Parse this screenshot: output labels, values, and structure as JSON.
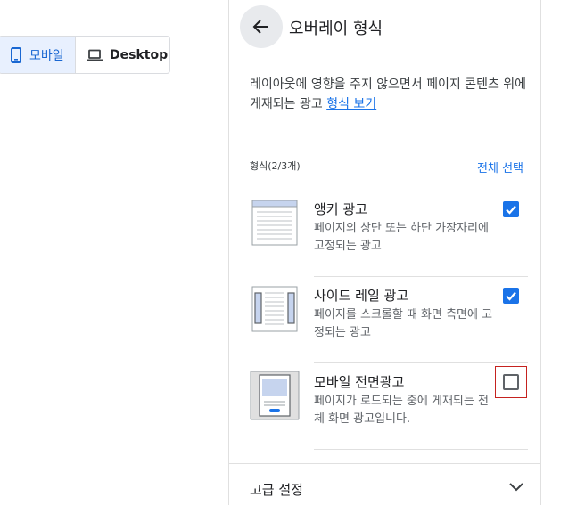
{
  "device_toggle": {
    "mobile_label": "모바일",
    "desktop_label": "Desktop",
    "selected": "mobile"
  },
  "panel": {
    "title": "오버레이 형식",
    "description": "레이아웃에 영향을 주지 않으면서 페이지 콘텐츠 위에 게재되는 광고",
    "description_link": "형식 보기",
    "formats_label": "형식(2/3개)",
    "select_all": "전체 선택",
    "formats": [
      {
        "name": "앵커 광고",
        "desc": "페이지의 상단 또는 하단 가장자리에 고정되는 광고",
        "checked": true
      },
      {
        "name": "사이드 레일 광고",
        "desc": "페이지를 스크롤할 때 화면 측면에 고정되는 광고",
        "checked": true
      },
      {
        "name": "모바일 전면광고",
        "desc": "페이지가 로드되는 중에 게재되는 전체 화면 광고입니다.",
        "checked": false
      }
    ],
    "advanced_label": "고급 설정"
  },
  "colors": {
    "accent": "#1a73e8",
    "selected_bg": "#e8f0fe",
    "focus_outline": "#c5221f"
  }
}
